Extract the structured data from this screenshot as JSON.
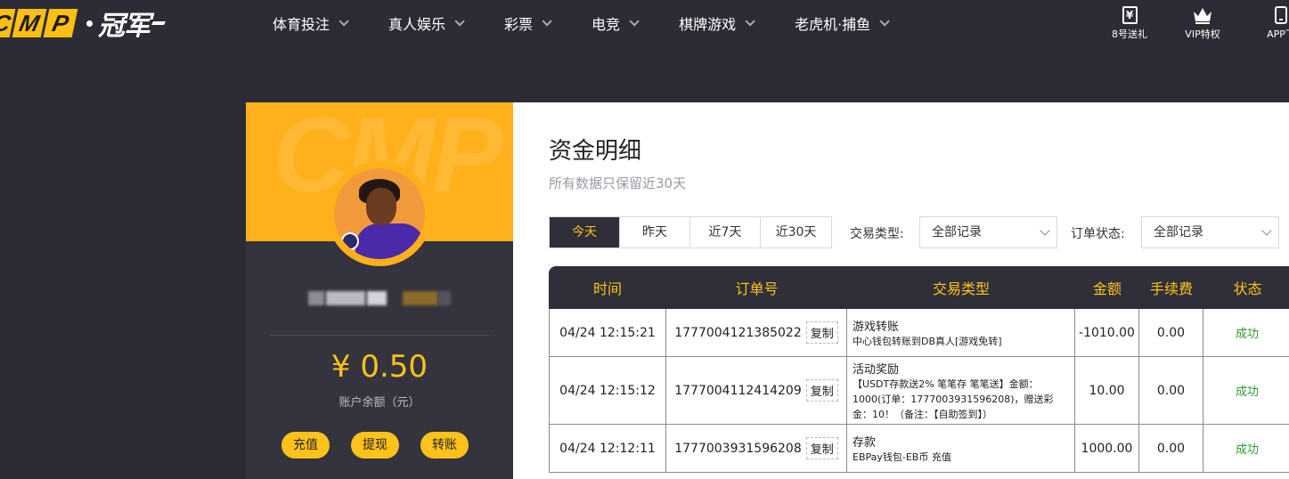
{
  "brand": {
    "logo_letters": [
      "C",
      "M",
      "P"
    ],
    "logo_cn": "冠军"
  },
  "nav": {
    "items": [
      "体育投注",
      "真人娱乐",
      "彩票",
      "电竞",
      "棋牌游戏",
      "老虎机·捕鱼"
    ]
  },
  "quick": {
    "gift_icon_char": "¥",
    "gift_label": "8号送礼",
    "vip_label": "VIP特权",
    "app_label": "APP下"
  },
  "profile": {
    "banner_watermark": "CMP",
    "balance": "¥ 0.50",
    "balance_label": "账户余额（元）",
    "actions": {
      "deposit": "充值",
      "withdraw": "提现",
      "transfer": "转账"
    }
  },
  "main": {
    "title": "资金明细",
    "subtitle": "所有数据只保留近30天",
    "range_tabs": [
      "今天",
      "昨天",
      "近7天",
      "近30天"
    ],
    "active_range": "今天",
    "filters": {
      "type_label": "交易类型:",
      "type_value": "全部记录",
      "status_label": "订单状态:",
      "status_value": "全部记录"
    },
    "table": {
      "headers": [
        "时间",
        "订单号",
        "交易类型",
        "金额",
        "手续费",
        "状态"
      ],
      "copy_label": "复制",
      "rows": [
        {
          "time": "04/24 12:15:21",
          "order": "1777004121385022",
          "type": "游戏转账",
          "desc": "中心钱包转账到DB真人[游戏免转]",
          "amount": "-1010.00",
          "fee": "0.00",
          "status": "成功"
        },
        {
          "time": "04/24 12:15:12",
          "order": "1777004112414209",
          "type": "活动奖励",
          "desc": "【USDT存款送2% 笔笔存 笔笔送】金额：1000(订单：1777003931596208)，赠送彩金：10！（备注：【自助签到】）",
          "amount": "10.00",
          "fee": "0.00",
          "status": "成功"
        },
        {
          "time": "04/24 12:12:11",
          "order": "1777003931596208",
          "type": "存款",
          "desc": "EBPay钱包-EB币 充值",
          "amount": "1000.00",
          "fee": "0.00",
          "status": "成功"
        }
      ]
    }
  },
  "colors": {
    "accent": "#ffc21a",
    "dark_bg": "#2c2c36",
    "success": "#2a9a2a"
  }
}
